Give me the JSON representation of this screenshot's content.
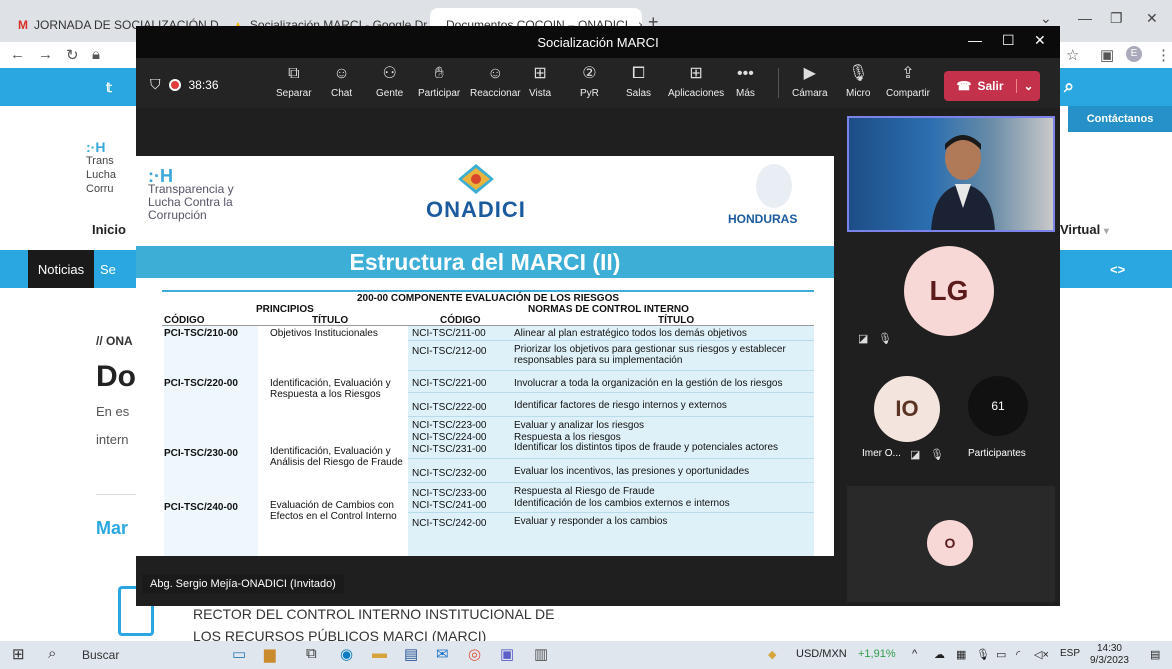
{
  "browser": {
    "tabs": [
      {
        "label": "JORNADA DE SOCIALIZACIÓN D",
        "icon": "gmail-icon"
      },
      {
        "label": "Socialización MARCI - Google Dr",
        "icon": "drive-icon"
      },
      {
        "label": "Documentos COCOIN – ONADICI",
        "icon": "page-icon"
      }
    ],
    "close_glyph": "×",
    "new_tab": "+"
  },
  "website": {
    "contact": "Contáctanos",
    "logo_lines": [
      "Trans",
      "Lucha",
      "Corru"
    ],
    "inicio": "Inicio",
    "virtual": "Virtual",
    "noticias": "Noticias",
    "seg": "Se",
    "onadici_crumb": "// ONA",
    "heading": "Do",
    "text1": "En es",
    "text2": "intern",
    "mar": "Mar",
    "footer_line1": "RECTOR DEL CONTROL INTERNO INSTITUCIONAL DE",
    "footer_line2": "LOS RECURSOS PÚBLICOS MARCI (MARCI)"
  },
  "teams": {
    "window_title": "Socialización MARCI",
    "timer": "38:36",
    "toolbar": [
      {
        "label": "Separar",
        "icon": "separate-icon"
      },
      {
        "label": "Chat",
        "icon": "chat-icon"
      },
      {
        "label": "Gente",
        "icon": "people-icon"
      },
      {
        "label": "Participar",
        "icon": "raise-hand-icon"
      },
      {
        "label": "Reaccionar",
        "icon": "react-icon"
      },
      {
        "label": "Vista",
        "icon": "view-icon"
      },
      {
        "label": "PyR",
        "icon": "qa-icon"
      },
      {
        "label": "Salas",
        "icon": "rooms-icon"
      },
      {
        "label": "Aplicaciones",
        "icon": "apps-icon"
      },
      {
        "label": "Más",
        "icon": "more-icon"
      },
      {
        "label": "Cámara",
        "icon": "camera-off-icon"
      },
      {
        "label": "Micro",
        "icon": "mic-off-icon"
      },
      {
        "label": "Compartir",
        "icon": "share-icon"
      }
    ],
    "leave": "Salir",
    "presenter": "Abg. Sergio Mejía-ONADICI (Invitado)",
    "participants": {
      "lg": "LG",
      "io": "IO",
      "io_name": "Imer O...",
      "count": "61",
      "count_label": "Participantes",
      "o": "O"
    }
  },
  "slide": {
    "tlc_lines": [
      "Transparencia y",
      "Lucha Contra la",
      "Corrupción"
    ],
    "onadici": "ONADICI",
    "honduras": "HONDURAS",
    "title": "Estructura del MARCI (II)",
    "table_title": "200-00 COMPONENTE EVALUACIÓN DE LOS RIESGOS",
    "principios": "PRINCIPIOS",
    "normas": "NORMAS DE CONTROL INTERNO",
    "col_codigo": "CÓDIGO",
    "col_titulo": "TÍTULO",
    "principles": [
      {
        "code": "PCI-TSC/210-00",
        "title": "Objetivos Institucionales"
      },
      {
        "code": "PCI-TSC/220-00",
        "title": "Identificación, Evaluación y Respuesta a los Riesgos"
      },
      {
        "code": "PCI-TSC/230-00",
        "title": "Identificación, Evaluación y Análisis del Riesgo de Fraude"
      },
      {
        "code": "PCI-TSC/240-00",
        "title": "Evaluación de Cambios con Efectos en el Control Interno"
      }
    ],
    "norms": [
      {
        "code": "NCI-TSC/211-00",
        "title": "Alinear al plan estratégico todos los demás objetivos"
      },
      {
        "code": "NCI-TSC/212-00",
        "title": "Priorizar los objetivos para gestionar sus riesgos y establecer responsables para su implementación"
      },
      {
        "code": "NCI-TSC/221-00",
        "title": "Involucrar a toda la organización en la gestión de los riesgos"
      },
      {
        "code": "NCI-TSC/222-00",
        "title": "Identificar factores de riesgo internos y externos"
      },
      {
        "code": "NCI-TSC/223-00",
        "title": "Evaluar y analizar los riesgos"
      },
      {
        "code": "NCI-TSC/224-00",
        "title": "Respuesta a los riesgos"
      },
      {
        "code": "NCI-TSC/231-00",
        "title": "Identificar los distintos tipos de fraude y potenciales actores"
      },
      {
        "code": "NCI-TSC/232-00",
        "title": "Evaluar los incentivos, las presiones y oportunidades"
      },
      {
        "code": "NCI-TSC/233-00",
        "title": "Respuesta al Riesgo de Fraude"
      },
      {
        "code": "NCI-TSC/241-00",
        "title": "Identificación de los cambios externos e internos"
      },
      {
        "code": "NCI-TSC/242-00",
        "title": "Evaluar y responder a los cambios"
      }
    ]
  },
  "taskbar": {
    "search": "Buscar",
    "currency": "USD/MXN",
    "change": "+1,91%",
    "lang": "ESP",
    "time": "14:30",
    "date": "9/3/2023"
  },
  "colors": {
    "accent_blue": "#3daed6",
    "leave_red": "#c4314b",
    "teams_purple": "#7b83eb"
  }
}
